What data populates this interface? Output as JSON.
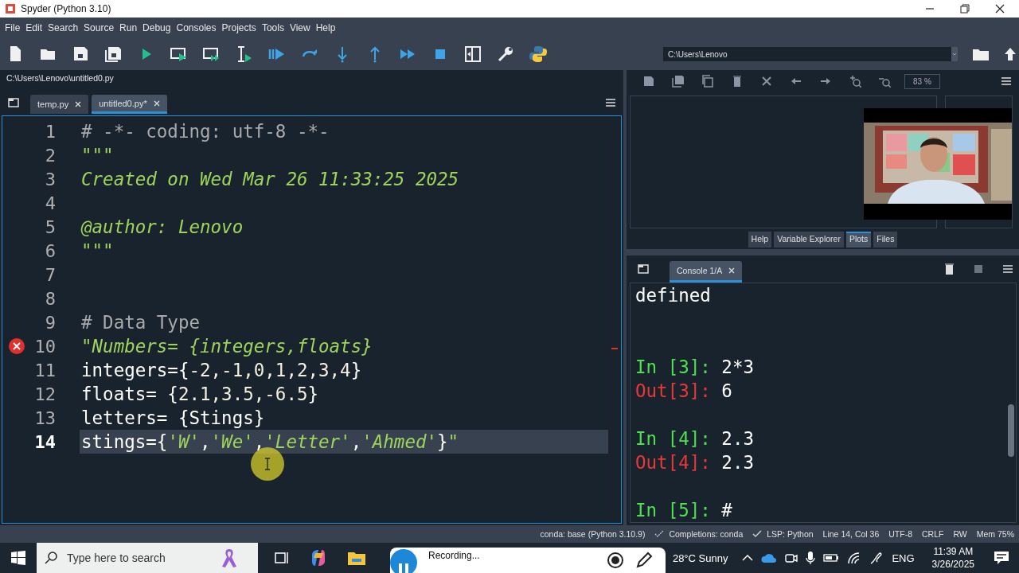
{
  "window": {
    "title": "Spyder (Python 3.10)"
  },
  "menu": [
    "File",
    "Edit",
    "Search",
    "Source",
    "Run",
    "Debug",
    "Consoles",
    "Projects",
    "Tools",
    "View",
    "Help"
  ],
  "toolbar": {
    "working_directory": "C:\\Users\\Lenovo"
  },
  "editor": {
    "file_path": "C:\\Users\\Lenovo\\untitled0.py",
    "tabs": [
      {
        "label": "temp.py",
        "selected": false
      },
      {
        "label": "untitled0.py*",
        "selected": true
      }
    ],
    "lines": [
      {
        "number": "1",
        "current": false,
        "error": false,
        "tokens": [
          {
            "text": "# -*- coding: utf-8 -*-",
            "kind": "comment"
          }
        ]
      },
      {
        "number": "2",
        "current": false,
        "error": false,
        "tokens": [
          {
            "text": "\"\"\"",
            "kind": "string"
          }
        ]
      },
      {
        "number": "3",
        "current": false,
        "error": false,
        "tokens": [
          {
            "text": "Created on Wed Mar 26 11:33:25 2025",
            "kind": "string"
          }
        ]
      },
      {
        "number": "4",
        "current": false,
        "error": false
      },
      {
        "number": "5",
        "current": false,
        "error": false,
        "tokens": [
          {
            "text": "@author: Lenovo",
            "kind": "string"
          }
        ]
      },
      {
        "number": "6",
        "current": false,
        "error": false,
        "tokens": [
          {
            "text": "\"\"\"",
            "kind": "string"
          }
        ]
      },
      {
        "number": "7",
        "current": false,
        "error": false
      },
      {
        "number": "8",
        "current": false,
        "error": false
      },
      {
        "number": "9",
        "current": false,
        "error": false,
        "tokens": [
          {
            "text": "# Data Type",
            "kind": "comment"
          }
        ]
      },
      {
        "number": "10",
        "current": false,
        "error": true,
        "tokens": [
          {
            "text": "\"Numbers= {integers,floats}",
            "kind": "string"
          }
        ]
      },
      {
        "number": "11",
        "current": false,
        "error": false,
        "tokens": [
          {
            "text": "integers={",
            "kind": "plain"
          },
          {
            "text": "-2,-1,0,1,2,3,4",
            "kind": "number"
          },
          {
            "text": "}",
            "kind": "plain"
          }
        ]
      },
      {
        "number": "12",
        "current": false,
        "error": false,
        "tokens": [
          {
            "text": "floats= {",
            "kind": "plain"
          },
          {
            "text": "2.1,3.5,-6.5",
            "kind": "number"
          },
          {
            "text": "}",
            "kind": "plain"
          }
        ]
      },
      {
        "number": "13",
        "current": false,
        "error": false,
        "tokens": [
          {
            "text": "letters= {Stings}",
            "kind": "plain"
          }
        ]
      },
      {
        "number": "14",
        "current": true,
        "error": false,
        "tokens": [
          {
            "text": "stings={",
            "kind": "plain"
          },
          {
            "text": "'W'",
            "kind": "string"
          },
          {
            "text": ",",
            "kind": "plain"
          },
          {
            "text": "'We'",
            "kind": "string"
          },
          {
            "text": ",",
            "kind": "plain"
          },
          {
            "text": "'Letter'",
            "kind": "string"
          },
          {
            "text": ",",
            "kind": "plain"
          },
          {
            "text": "'Ahmed'",
            "kind": "string"
          },
          {
            "text": "}",
            "kind": "plain"
          },
          {
            "text": "\"",
            "kind": "string"
          }
        ]
      }
    ]
  },
  "plots": {
    "zoom": "83 %",
    "tabs": [
      {
        "label": "Help",
        "selected": false
      },
      {
        "label": "Variable Explorer",
        "selected": false
      },
      {
        "label": "Plots",
        "selected": true
      },
      {
        "label": "Files",
        "selected": false
      }
    ]
  },
  "console": {
    "tab": "Console 1/A",
    "lines": [
      {
        "kind": "text",
        "tokens": [
          {
            "text": "defined",
            "kind": "plain"
          }
        ]
      },
      {
        "kind": "blank"
      },
      {
        "kind": "blank"
      },
      {
        "kind": "text",
        "tokens": [
          {
            "text": "In [3]:",
            "kind": "in"
          },
          {
            "text": " 2*3",
            "kind": "plain"
          }
        ]
      },
      {
        "kind": "text",
        "tokens": [
          {
            "text": "Out[3]:",
            "kind": "out"
          },
          {
            "text": " 6",
            "kind": "plain"
          }
        ]
      },
      {
        "kind": "blank"
      },
      {
        "kind": "text",
        "tokens": [
          {
            "text": "In [4]:",
            "kind": "in"
          },
          {
            "text": " 2.3",
            "kind": "plain"
          }
        ]
      },
      {
        "kind": "text",
        "tokens": [
          {
            "text": "Out[4]:",
            "kind": "out"
          },
          {
            "text": " 2.3",
            "kind": "plain"
          }
        ]
      },
      {
        "kind": "blank"
      },
      {
        "kind": "text",
        "tokens": [
          {
            "text": "In [5]:",
            "kind": "in"
          },
          {
            "text": " #",
            "kind": "plain"
          }
        ]
      }
    ]
  },
  "status_bar": [
    "conda: base (Python 3.10.9)",
    "Completions: conda",
    "LSP: Python",
    "Line 14, Col 36",
    "UTF-8",
    "CRLF",
    "RW",
    "Mem 75%"
  ],
  "taskbar": {
    "search_placeholder": "Type here to search",
    "weather": "28°C  Sunny",
    "language": "ENG",
    "time": "11:39 AM",
    "date": "3/26/2025"
  },
  "recording": {
    "label": "Recording..."
  }
}
